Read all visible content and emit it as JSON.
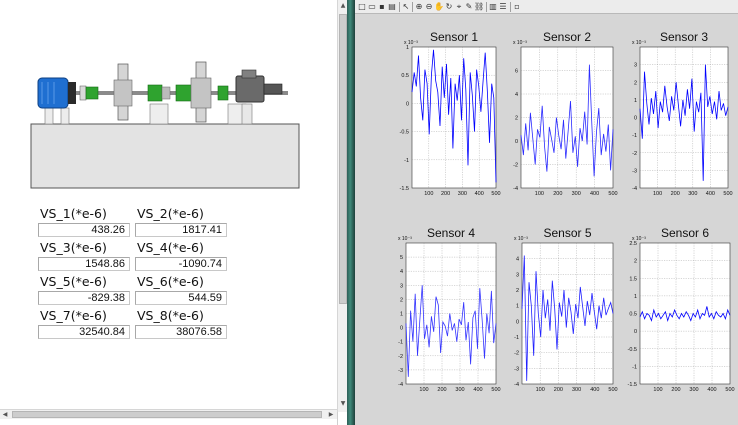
{
  "left_panel": {
    "readings": [
      {
        "label": "VS_1(*e-6)",
        "value": "438.26"
      },
      {
        "label": "VS_2(*e-6)",
        "value": "1817.41"
      },
      {
        "label": "VS_3(*e-6)",
        "value": "1548.86"
      },
      {
        "label": "VS_4(*e-6)",
        "value": "-1090.74"
      },
      {
        "label": "VS_5(*e-6)",
        "value": "-829.38"
      },
      {
        "label": "VS_6(*e-6)",
        "value": "544.59"
      },
      {
        "label": "VS_7(*e-6)",
        "value": "32540.84"
      },
      {
        "label": "VS_8(*e-6)",
        "value": "38076.58"
      }
    ],
    "machine_colors": {
      "motor": "#1f6fd1",
      "coupling": "#2fa32f",
      "base": "#e3e3e3"
    }
  },
  "toolbar": {
    "icons": [
      "new-icon",
      "open-icon",
      "save-icon",
      "print-icon",
      "pointer-icon",
      "zoom-in-icon",
      "zoom-out-icon",
      "pan-icon",
      "rotate-icon",
      "data-cursor-icon",
      "brush-icon",
      "link-icon",
      "colorbar-icon",
      "legend-icon",
      "hide-tools-icon"
    ]
  },
  "chart_data": [
    {
      "type": "line",
      "title": "Sensor 1",
      "exponent": "x 10⁻³",
      "xlim": [
        0,
        500
      ],
      "ylim": [
        -1.5,
        1
      ],
      "xticks": [
        "100",
        "200",
        "300",
        "400",
        "500"
      ],
      "yticks": [
        "1",
        "0.5",
        "0",
        "-0.5",
        "-1",
        "-1.5"
      ],
      "series": [
        {
          "color": "#0000ff",
          "values": [
            0.2,
            0.55,
            0.3,
            0.85,
            0.1,
            -0.3,
            0.6,
            0.35,
            -0.55,
            0.5,
            0.95,
            0.4,
            0.2,
            -0.4,
            0.65,
            0.1,
            0.7,
            -0.2,
            0.45,
            -0.8,
            0.35,
            0.05,
            0.5,
            -0.3,
            0.8,
            0.25,
            -1.1,
            0.55,
            0.15,
            -0.5,
            0.6,
            0.3,
            -0.15,
            0.4,
            0.9,
            0.2,
            -0.7,
            0.35,
            0.1,
            -1.4
          ]
        }
      ]
    },
    {
      "type": "line",
      "title": "Sensor 2",
      "exponent": "x 10⁻³",
      "xlim": [
        0,
        500
      ],
      "ylim": [
        -4,
        8
      ],
      "xticks": [
        "100",
        "200",
        "300",
        "400",
        "500"
      ],
      "yticks": [
        "6",
        "4",
        "2",
        "0",
        "-2",
        "-4"
      ],
      "series": [
        {
          "color": "#2b2bff",
          "values": [
            0.5,
            -1.2,
            1.5,
            -0.8,
            2.4,
            0.2,
            -2.0,
            1.0,
            0.3,
            3.0,
            -0.5,
            -2.6,
            1.2,
            0.1,
            -1.0,
            2.0,
            0.5,
            -0.7,
            1.8,
            -1.5,
            0.9,
            3.4,
            -1.0,
            0.4,
            -2.2,
            1.1,
            0.0,
            2.5,
            -0.3,
            6.5,
            1.5,
            -3.0,
            0.8,
            2.8,
            -1.2,
            0.6,
            -0.9,
            1.4,
            -2.5,
            1.0
          ]
        }
      ]
    },
    {
      "type": "line",
      "title": "Sensor 3",
      "exponent": "x 10⁻³",
      "xlim": [
        0,
        500
      ],
      "ylim": [
        -4,
        4
      ],
      "xticks": [
        "100",
        "200",
        "300",
        "400",
        "500"
      ],
      "yticks": [
        "3",
        "2",
        "1",
        "0",
        "-1",
        "-2",
        "-3",
        "-4"
      ],
      "series": [
        {
          "color": "#0000ff",
          "values": [
            0.5,
            -1.2,
            2.6,
            0.8,
            -0.4,
            1.1,
            0.2,
            1.5,
            -0.6,
            0.9,
            0.3,
            1.8,
            0.6,
            -0.2,
            1.2,
            0.4,
            2.0,
            0.7,
            -0.5,
            1.0,
            0.1,
            1.6,
            0.5,
            2.2,
            -0.8,
            0.9,
            0.3,
            1.4,
            -3.6,
            3.0,
            0.6,
            1.2,
            0.2,
            0.9,
            -0.1,
            1.5,
            0.4,
            0.8,
            0.1,
            0.6
          ]
        }
      ]
    },
    {
      "type": "line",
      "title": "Sensor 4",
      "exponent": "x 10⁻³",
      "xlim": [
        0,
        500
      ],
      "ylim": [
        -4,
        6
      ],
      "xticks": [
        "100",
        "200",
        "300",
        "400",
        "500"
      ],
      "yticks": [
        "5",
        "4",
        "3",
        "2",
        "1",
        "0",
        "-1",
        "-2",
        "-3",
        "-4"
      ],
      "series": [
        {
          "color": "#3535ff",
          "values": [
            0.3,
            -3.5,
            1.2,
            -1.0,
            2.4,
            -2.0,
            0.5,
            3.0,
            -0.8,
            0.2,
            -1.4,
            0.8,
            -0.3,
            2.2,
            1.6,
            -1.8,
            0.4,
            0.1,
            -0.6,
            1.0,
            -0.2,
            0.3,
            -1.0,
            0.6,
            0.2,
            1.8,
            -0.9,
            0.4,
            -2.6,
            0.7,
            1.2,
            -1.5,
            2.8,
            0.5,
            -2.2,
            1.0,
            -0.4,
            2.6,
            -1.1,
            0.3
          ]
        }
      ]
    },
    {
      "type": "line",
      "title": "Sensor 5",
      "exponent": "x 10⁻³",
      "xlim": [
        0,
        500
      ],
      "ylim": [
        -4,
        5
      ],
      "xticks": [
        "100",
        "200",
        "300",
        "400",
        "500"
      ],
      "yticks": [
        "4",
        "3",
        "2",
        "1",
        "0",
        "-1",
        "-2",
        "-3",
        "-4"
      ],
      "series": [
        {
          "color": "#2020ff",
          "values": [
            0.8,
            4.2,
            -3.8,
            2.5,
            1.0,
            -2.2,
            3.2,
            0.5,
            -1.0,
            2.0,
            0.2,
            1.4,
            -0.6,
            2.6,
            0.8,
            -1.8,
            1.2,
            0.3,
            2.0,
            -0.4,
            1.5,
            0.6,
            -0.8,
            1.1,
            0.2,
            2.2,
            0.9,
            -0.3,
            1.3,
            0.4,
            1.8,
            0.6,
            -0.5,
            1.0,
            0.2,
            1.5,
            0.4,
            0.8,
            1.2,
            0.5
          ]
        }
      ]
    },
    {
      "type": "line",
      "title": "Sensor 6",
      "exponent": "x 10⁻³",
      "xlim": [
        0,
        500
      ],
      "ylim": [
        -1.5,
        2.5
      ],
      "xticks": [
        "100",
        "200",
        "300",
        "400",
        "500"
      ],
      "yticks": [
        "2.5",
        "2",
        "1.5",
        "1",
        "0.5",
        "0",
        "-0.5",
        "-1",
        "-1.5"
      ],
      "series": [
        {
          "color": "#0000ff",
          "values": [
            0.4,
            0.55,
            0.35,
            0.5,
            0.45,
            0.3,
            0.6,
            0.4,
            0.5,
            0.35,
            0.45,
            0.55,
            0.3,
            0.5,
            0.4,
            0.6,
            0.45,
            0.35,
            0.5,
            0.4,
            0.55,
            0.45,
            0.3,
            0.5,
            0.4,
            0.6,
            0.35,
            0.5,
            0.45,
            0.7,
            0.4,
            0.5,
            0.35,
            0.55,
            0.45,
            0.4,
            0.5,
            0.35,
            0.6,
            0.45
          ]
        }
      ]
    }
  ]
}
